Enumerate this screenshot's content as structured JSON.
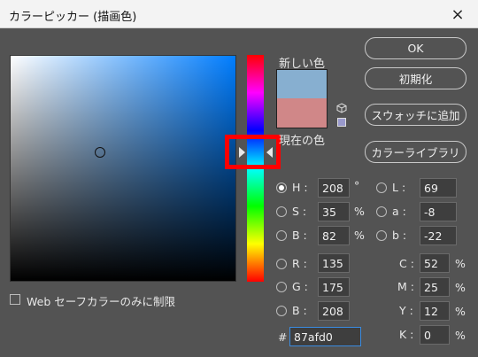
{
  "window": {
    "title": "カラーピッカー (描画色)",
    "close_icon": "×"
  },
  "swatches": {
    "new_label": "新しい色",
    "current_label": "現在の色",
    "new_color": "#87afd0",
    "current_color": "#d08788"
  },
  "buttons": {
    "ok": "OK",
    "reset": "初期化",
    "add_swatch": "スウォッチに追加",
    "color_library": "カラーライブラリ"
  },
  "hsb": {
    "h": {
      "label": "H :",
      "value": "208",
      "unit": "°"
    },
    "s": {
      "label": "S :",
      "value": "35",
      "unit": "%"
    },
    "b": {
      "label": "B :",
      "value": "82",
      "unit": "%"
    }
  },
  "rgb": {
    "r": {
      "label": "R :",
      "value": "135"
    },
    "g": {
      "label": "G :",
      "value": "175"
    },
    "b": {
      "label": "B :",
      "value": "208"
    }
  },
  "lab": {
    "l": {
      "label": "L :",
      "value": "69"
    },
    "a": {
      "label": "a :",
      "value": "-8"
    },
    "b": {
      "label": "b :",
      "value": "-22"
    }
  },
  "cmyk": {
    "c": {
      "label": "C :",
      "value": "52",
      "unit": "%"
    },
    "m": {
      "label": "M :",
      "value": "25",
      "unit": "%"
    },
    "y": {
      "label": "Y :",
      "value": "12",
      "unit": "%"
    },
    "k": {
      "label": "K :",
      "value": "0",
      "unit": "%"
    }
  },
  "hex": {
    "label": "#",
    "value": "87afd0"
  },
  "web_safe": {
    "label": "Web セーフカラーのみに制限"
  }
}
